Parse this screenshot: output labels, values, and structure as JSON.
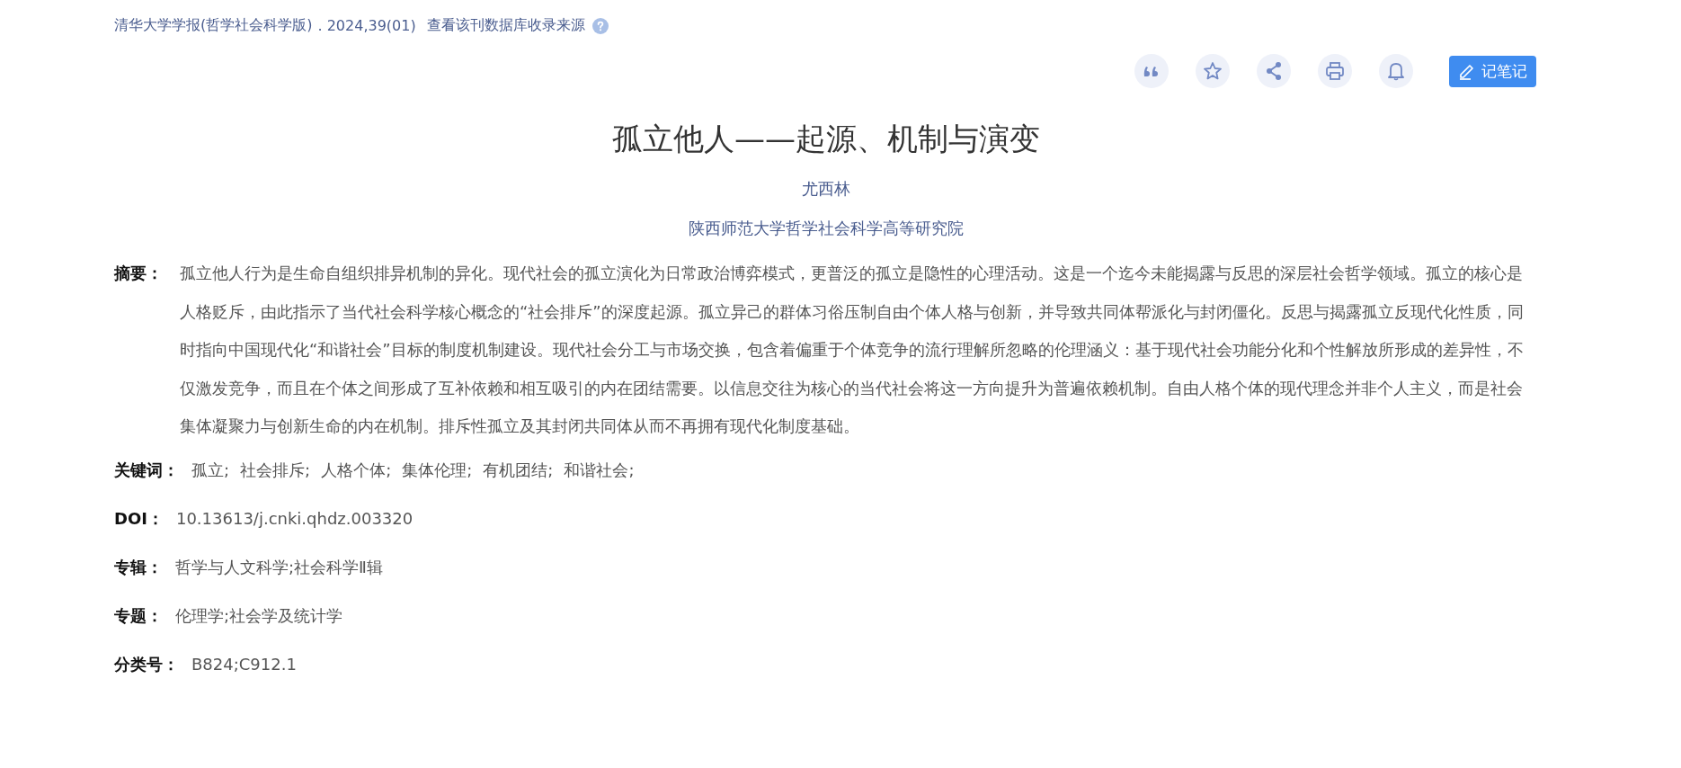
{
  "source": {
    "journal": "清华大学学报(哲学社会科学版)",
    "issue": ". 2024,39(01)",
    "db_link": "查看该刊数据库收录来源"
  },
  "toolbar": {
    "note_button": "记笔记"
  },
  "article": {
    "title": "孤立他人——起源、机制与演变",
    "author": "尤西林",
    "institution": "陕西师范大学哲学社会科学高等研究院"
  },
  "abstract": {
    "label": "摘要：",
    "text": "孤立他人行为是生命自组织排异机制的异化。现代社会的孤立演化为日常政治博弈模式，更普泛的孤立是隐性的心理活动。这是一个迄今未能揭露与反思的深层社会哲学领域。孤立的核心是人格贬斥，由此指示了当代社会科学核心概念的“社会排斥”的深度起源。孤立异己的群体习俗压制自由个体人格与创新，并导致共同体帮派化与封闭僵化。反思与揭露孤立反现代化性质，同时指向中国现代化“和谐社会”目标的制度机制建设。现代社会分工与市场交换，包含着偏重于个体竞争的流行理解所忽略的伦理涵义：基于现代社会功能分化和个性解放所形成的差异性，不仅激发竞争，而且在个体之间形成了互补依赖和相互吸引的内在团结需要。以信息交往为核心的当代社会将这一方向提升为普遍依赖机制。自由人格个体的现代理念并非个人主义，而是社会集体凝聚力与创新生命的内在机制。排斥性孤立及其封闭共同体从而不再拥有现代化制度基础。"
  },
  "keywords": {
    "label": "关键词：",
    "items": [
      "孤立;",
      "社会排斥;",
      "人格个体;",
      "集体伦理;",
      "有机团结;",
      "和谐社会;"
    ]
  },
  "fields": [
    {
      "label": "DOI：",
      "value": "10.13613/j.cnki.qhdz.003320"
    },
    {
      "label": "专辑：",
      "value": "哲学与人文科学;社会科学Ⅱ辑"
    },
    {
      "label": "专题：",
      "value": "伦理学;社会学及统计学"
    },
    {
      "label": "分类号：",
      "value": "B824;C912.1"
    }
  ]
}
